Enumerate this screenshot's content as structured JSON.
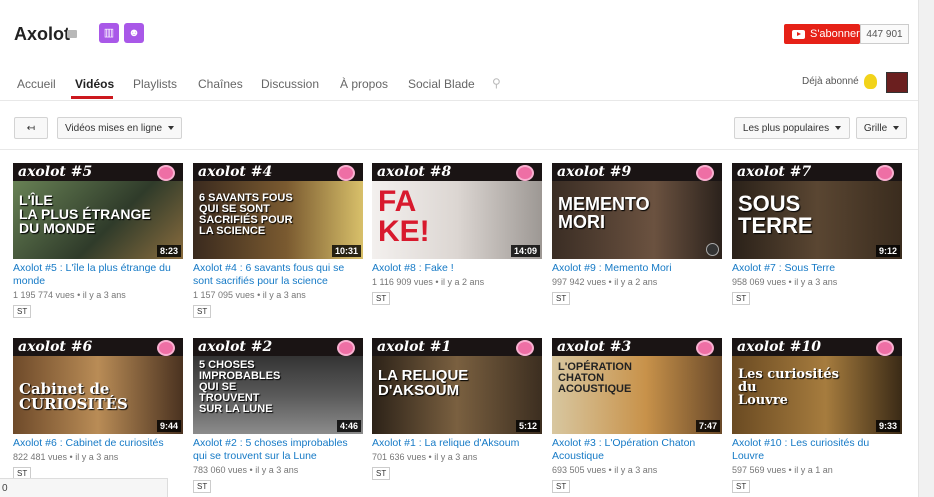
{
  "channel": {
    "name": "Axolot",
    "subscribe_label": "S'abonner",
    "subscriber_count": "447 901",
    "already_subscribed": "Déjà abonné"
  },
  "tabs": [
    "Accueil",
    "Vidéos",
    "Playlists",
    "Chaînes",
    "Discussion",
    "À propos",
    "Social Blade"
  ],
  "toolbar": {
    "uploaded_label": "Vidéos mises en ligne",
    "sort_label": "Les plus populaires",
    "view_label": "Grille"
  },
  "videos": [
    {
      "thumb_header": "axolot #5",
      "thumb_text": "L'ÎLE\nLA PLUS ÉTRANGE\nDU MONDE",
      "duration": "8:23",
      "title": "Axolot #5 : L'île la plus étrange du monde",
      "views": "1 195 774 vues",
      "age": "il y a 3 ans",
      "badge": "ST"
    },
    {
      "thumb_header": "axolot #4",
      "thumb_text": "6 SAVANTS FOUS\nQUI SE SONT\nSACRIFIÉS POUR\nLA SCIENCE",
      "duration": "10:31",
      "title": "Axolot #4 : 6 savants fous qui se sont sacrifiés pour la science",
      "views": "1 157 095 vues",
      "age": "il y a 3 ans",
      "badge": "ST"
    },
    {
      "thumb_header": "axolot #8",
      "thumb_text": "FA\nKE!",
      "duration": "14:09",
      "title": "Axolot #8 : Fake !",
      "views": "1 116 909 vues",
      "age": "il y a 2 ans",
      "badge": "ST"
    },
    {
      "thumb_header": "axolot #9",
      "thumb_text": "MEMENTO\nMORI",
      "duration": "",
      "title": "Axolot #9 : Memento Mori",
      "views": "997 942 vues",
      "age": "il y a 2 ans",
      "badge": "ST"
    },
    {
      "thumb_header": "axolot #7",
      "thumb_text": "SOUS\nTERRE",
      "duration": "9:12",
      "title": "Axolot #7 : Sous Terre",
      "views": "958 069 vues",
      "age": "il y a 3 ans",
      "badge": "ST"
    },
    {
      "thumb_header": "axolot #6",
      "thumb_text": "Cabinet de\nCURIOSITÉS",
      "duration": "9:44",
      "title": "Axolot #6 : Cabinet de curiosités",
      "views": "822 481 vues",
      "age": "il y a 3 ans",
      "badge": "ST"
    },
    {
      "thumb_header": "axolot #2",
      "thumb_text": "5 CHOSES\nIMPROBABLES\nQUI SE\nTROUVENT\nSUR LA LUNE",
      "duration": "4:46",
      "title": "Axolot #2 : 5 choses improbables qui se trouvent sur la Lune",
      "views": "783 060 vues",
      "age": "il y a 3 ans",
      "badge": "ST"
    },
    {
      "thumb_header": "axolot #1",
      "thumb_text": "LA RELIQUE\nD'AKSOUM",
      "duration": "5:12",
      "title": "Axolot #1 : La relique d'Aksoum",
      "views": "701 636 vues",
      "age": "il y a 3 ans",
      "badge": "ST"
    },
    {
      "thumb_header": "axolot #3",
      "thumb_text": "L'OPÉRATION\nCHATON\nACOUSTIQUE",
      "duration": "7:47",
      "title": "Axolot #3 : L'Opération Chaton Acoustique",
      "views": "693 505 vues",
      "age": "il y a 3 ans",
      "badge": "ST"
    },
    {
      "thumb_header": "axolot #10",
      "thumb_text": "Les curiosités\ndu\nLouvre",
      "duration": "9:33",
      "title": "Axolot #10 : Les curiosités du Louvre",
      "views": "597 569 vues",
      "age": "il y a 1 an",
      "badge": "ST"
    }
  ],
  "status_bar": "0",
  "colors": {
    "subscribe": "#e62117",
    "accent": "#cc181e",
    "link": "#167ac6",
    "badge_purple": "#a958e8"
  }
}
